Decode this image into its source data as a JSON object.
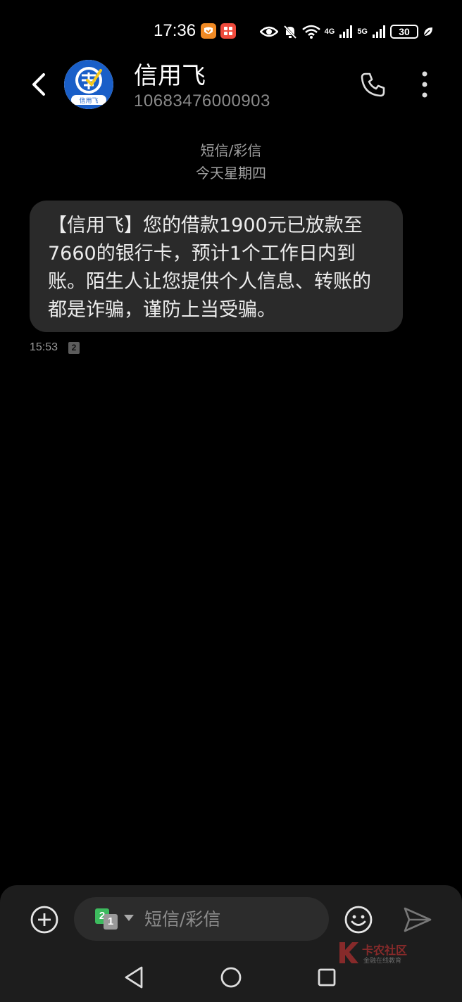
{
  "status_bar": {
    "time": "17:36",
    "network_1": "4G",
    "network_2": "5G",
    "battery": "30"
  },
  "header": {
    "contact_name": "信用飞",
    "contact_number": "10683476000903",
    "avatar_label": "信用飞"
  },
  "conversation": {
    "type_label": "短信/彩信",
    "date_label": "今天星期四"
  },
  "messages": [
    {
      "text": "【信用飞】您的借款1900元已放款至7660的银行卡，预计1个工作日内到账。陌生人让您提供个人信息、转账的都是诈骗，谨防上当受骗。",
      "time": "15:53",
      "sim": "2"
    }
  ],
  "compose": {
    "placeholder": "短信/彩信",
    "sim_front": "1",
    "sim_back": "2"
  },
  "watermark": {
    "title": "卡农社区",
    "subtitle": "金融在线教育"
  },
  "colors": {
    "background": "#000000",
    "bubble": "#2a2a2a",
    "compose_bar": "#1d1d1d",
    "sim2_green": "#3dbb5e",
    "avatar_blue": "#1a5fc8"
  }
}
